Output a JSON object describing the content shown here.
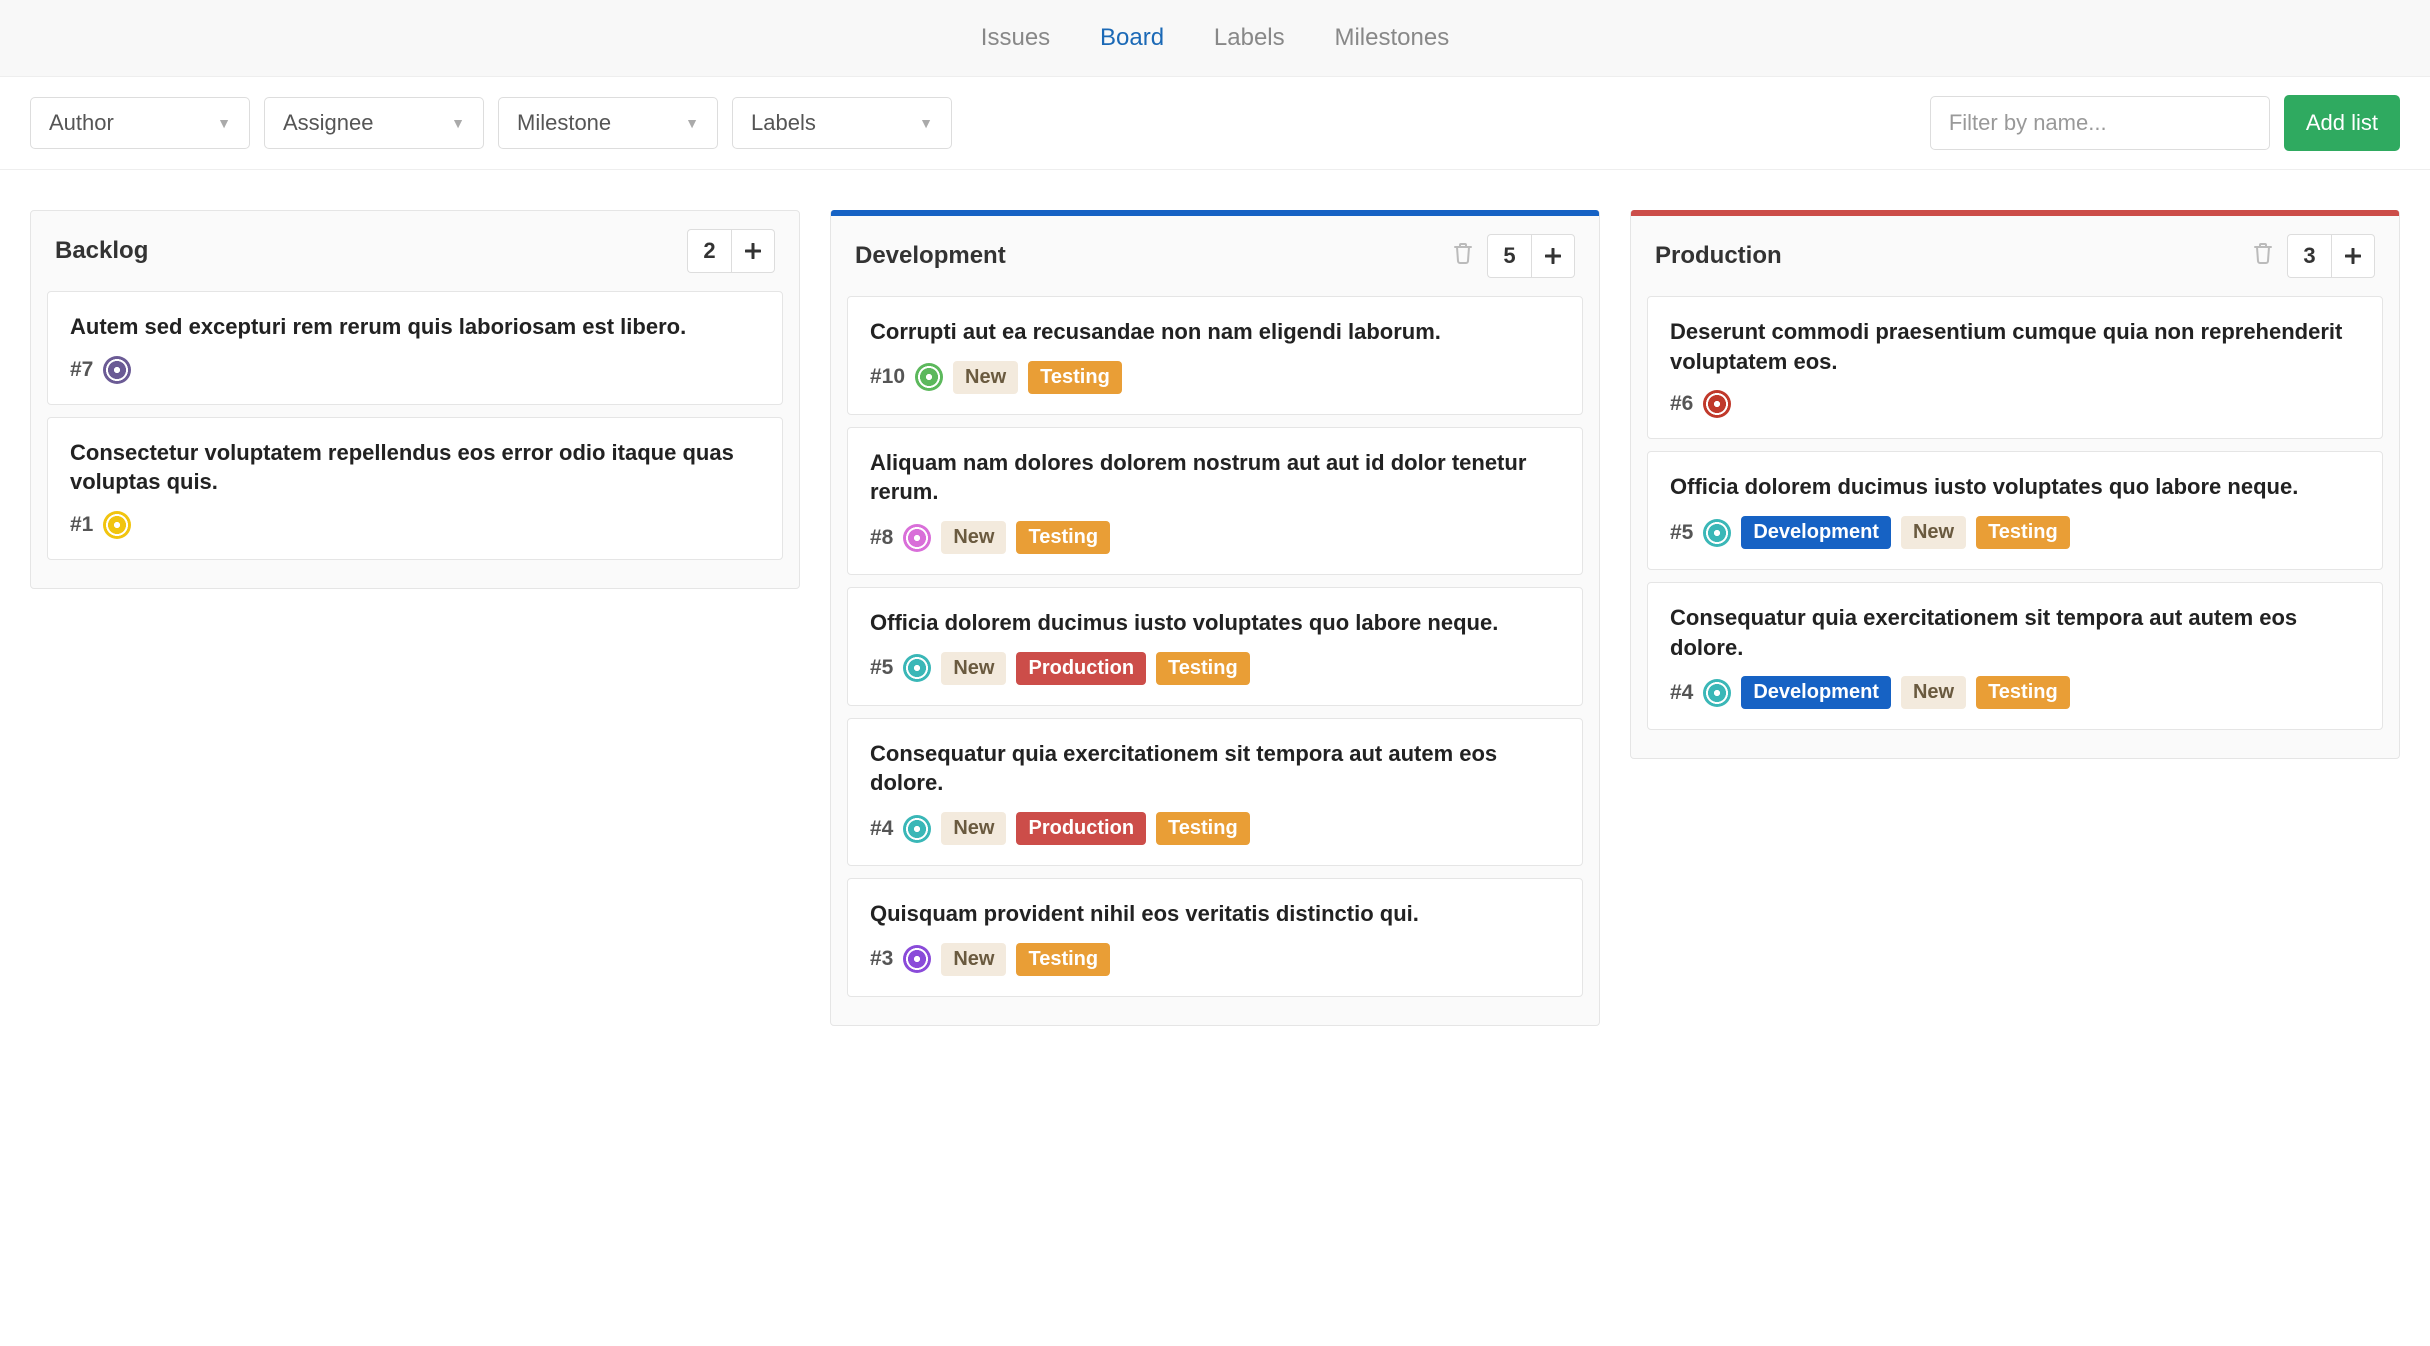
{
  "nav": {
    "items": [
      {
        "key": "issues",
        "label": "Issues",
        "active": false
      },
      {
        "key": "board",
        "label": "Board",
        "active": true
      },
      {
        "key": "labels",
        "label": "Labels",
        "active": false
      },
      {
        "key": "milestones",
        "label": "Milestones",
        "active": false
      }
    ]
  },
  "filters": {
    "author": "Author",
    "assignee": "Assignee",
    "milestone": "Milestone",
    "labels": "Labels",
    "search_placeholder": "Filter by name...",
    "add_list": "Add list"
  },
  "label_styles": {
    "New": "label-new",
    "Testing": "label-testing",
    "Development": "label-development",
    "Production": "label-production"
  },
  "avatar_colors": {
    "purple": "#6b5b95",
    "green": "#5cb85c",
    "pink": "#d96fd9",
    "teal": "#3ab7b7",
    "violet": "#8a4bd9",
    "red": "#c0392b",
    "yellow": "#f1c40f"
  },
  "boards": [
    {
      "id": "backlog",
      "title": "Backlog",
      "count": "2",
      "color": null,
      "deletable": false,
      "cards": [
        {
          "title": "Autem sed excepturi rem rerum quis laboriosam est libero.",
          "id": "#7",
          "avatar": "purple",
          "labels": []
        },
        {
          "title": "Consectetur voluptatem repellendus eos error odio itaque quas voluptas quis.",
          "id": "#1",
          "avatar": "yellow",
          "labels": []
        }
      ]
    },
    {
      "id": "development",
      "title": "Development",
      "count": "5",
      "color": "#1662c4",
      "deletable": true,
      "cards": [
        {
          "title": "Corrupti aut ea recusandae non nam eligendi laborum.",
          "id": "#10",
          "avatar": "green",
          "labels": [
            "New",
            "Testing"
          ]
        },
        {
          "title": "Aliquam nam dolores dolorem nostrum aut aut id dolor tenetur rerum.",
          "id": "#8",
          "avatar": "pink",
          "labels": [
            "New",
            "Testing"
          ]
        },
        {
          "title": "Officia dolorem ducimus iusto voluptates quo labore neque.",
          "id": "#5",
          "avatar": "teal",
          "labels": [
            "New",
            "Production",
            "Testing"
          ]
        },
        {
          "title": "Consequatur quia exercitationem sit tempora aut autem eos dolore.",
          "id": "#4",
          "avatar": "teal",
          "labels": [
            "New",
            "Production",
            "Testing"
          ]
        },
        {
          "title": "Quisquam provident nihil eos veritatis distinctio qui.",
          "id": "#3",
          "avatar": "violet",
          "labels": [
            "New",
            "Testing"
          ]
        }
      ]
    },
    {
      "id": "production",
      "title": "Production",
      "count": "3",
      "color": "#cc4d49",
      "deletable": true,
      "cards": [
        {
          "title": "Deserunt commodi praesentium cumque quia non reprehenderit voluptatem eos.",
          "id": "#6",
          "avatar": "red",
          "labels": []
        },
        {
          "title": "Officia dolorem ducimus iusto voluptates quo labore neque.",
          "id": "#5",
          "avatar": "teal",
          "labels": [
            "Development",
            "New",
            "Testing"
          ]
        },
        {
          "title": "Consequatur quia exercitationem sit tempora aut autem eos dolore.",
          "id": "#4",
          "avatar": "teal",
          "labels": [
            "Development",
            "New",
            "Testing"
          ]
        }
      ]
    }
  ]
}
